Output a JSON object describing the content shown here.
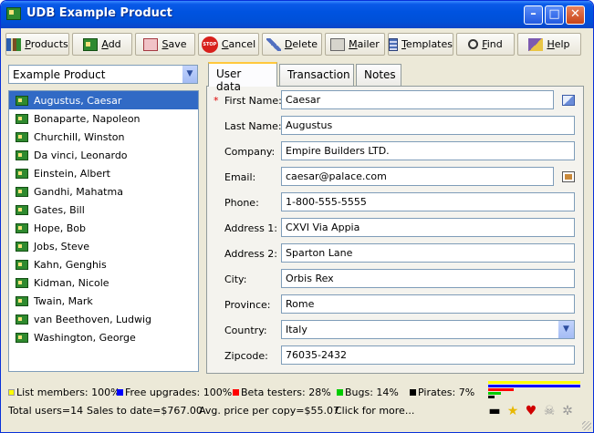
{
  "window": {
    "title": "UDB Example Product"
  },
  "toolbar": {
    "buttons": [
      {
        "label_ul": "P",
        "label_rest": "roducts"
      },
      {
        "label_ul": "A",
        "label_rest": "dd"
      },
      {
        "label_ul": "S",
        "label_rest": "ave"
      },
      {
        "label_ul": "C",
        "label_rest": "ancel"
      },
      {
        "label_ul": "D",
        "label_rest": "elete"
      },
      {
        "label_ul": "M",
        "label_rest": "ailer"
      },
      {
        "label_ul": "T",
        "label_rest": "emplates"
      },
      {
        "label_ul": "F",
        "label_rest": "ind"
      },
      {
        "label_ul": "H",
        "label_rest": "elp"
      }
    ],
    "stop_text": "STOP"
  },
  "product_select": {
    "value": "Example Product"
  },
  "contacts": [
    "Augustus, Caesar",
    "Bonaparte, Napoleon",
    "Churchill, Winston",
    "Da vinci, Leonardo",
    "Einstein, Albert",
    "Gandhi, Mahatma",
    "Gates, Bill",
    "Hope, Bob",
    "Jobs, Steve",
    "Kahn, Genghis",
    "Kidman, Nicole",
    "Twain, Mark",
    "van Beethoven, Ludwig",
    "Washington, George"
  ],
  "tabs": [
    "User data",
    "Transaction",
    "Notes"
  ],
  "form": {
    "required_mark": "*",
    "first_name": {
      "label": "First Name:",
      "value": "Caesar"
    },
    "last_name": {
      "label": "Last Name:",
      "value": "Augustus"
    },
    "company": {
      "label": "Company:",
      "value": "Empire Builders LTD."
    },
    "email": {
      "label": "Email:",
      "value": "caesar@palace.com"
    },
    "phone": {
      "label": "Phone:",
      "value": "1-800-555-5555"
    },
    "address1": {
      "label": "Address 1:",
      "value": "CXVI Via Appia"
    },
    "address2": {
      "label": "Address 2:",
      "value": "Sparton Lane"
    },
    "city": {
      "label": "City:",
      "value": "Orbis Rex"
    },
    "province": {
      "label": "Province:",
      "value": "Rome"
    },
    "country": {
      "label": "Country:",
      "value": "Italy"
    },
    "zipcode": {
      "label": "Zipcode:",
      "value": "76035-2432"
    }
  },
  "status": {
    "list_members": "List members: 100%",
    "free_upgrades": "Free upgrades: 100%",
    "beta_testers": "Beta testers: 28%",
    "bugs": "Bugs: 14%",
    "pirates": "Pirates: 7%",
    "total_users": "Total users=14",
    "sales": "Sales to date=$767.00",
    "avg_price": "Avg. price per copy=$55.07",
    "more": "Click for more...",
    "colors": {
      "list_members": "#ffff00",
      "free_upgrades": "#0000ff",
      "beta_testers": "#ff0000",
      "bugs": "#00cc00",
      "pirates": "#000000"
    },
    "bar_levels": {
      "list_members": 1.0,
      "free_upgrades": 1.0,
      "beta_testers": 0.28,
      "bugs": 0.14,
      "pirates": 0.07
    }
  }
}
